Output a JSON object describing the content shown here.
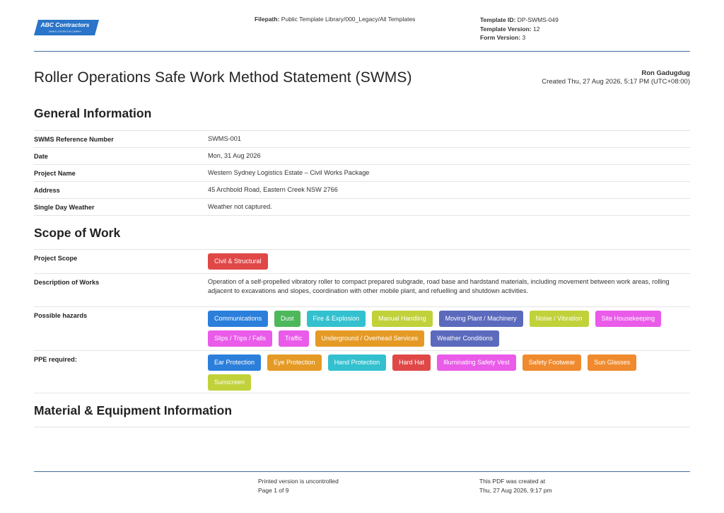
{
  "logo": {
    "name": "ABC Contractors",
    "subtitle": "SAMPLE CONTRACTOR COMPANY",
    "color": "#2a74c9"
  },
  "header": {
    "filepath_label": "Filepath:",
    "filepath_value": "Public Template Library/000_Legacy/All Templates",
    "template_id_label": "Template ID:",
    "template_id_value": "DP-SWMS-049",
    "template_version_label": "Template Version:",
    "template_version_value": "12",
    "form_version_label": "Form Version:",
    "form_version_value": "3"
  },
  "title": "Roller Operations Safe Work Method Statement (SWMS)",
  "created_by": "Ron Gadugdug",
  "created_at": "Created Thu, 27 Aug 2026, 5:17 PM (UTC+08:00)",
  "general": {
    "heading": "General Information",
    "rows": [
      {
        "label": "SWMS Reference Number",
        "value": "SWMS-001"
      },
      {
        "label": "Date",
        "value": "Mon, 31 Aug 2026"
      },
      {
        "label": "Project Name",
        "value": "Western Sydney Logistics Estate – Civil Works Package"
      },
      {
        "label": "Address",
        "value": "45 Archbold Road, Eastern Creek NSW 2766"
      },
      {
        "label": "Single Day Weather",
        "value": "Weather not captured."
      }
    ]
  },
  "scope": {
    "heading": "Scope of Work",
    "project_scope_label": "Project Scope",
    "project_scope_tags": [
      {
        "text": "Civil & Structural",
        "color": "#e04848"
      }
    ],
    "description_label": "Description of Works",
    "description": "Operation of a self-propelled vibratory roller to compact prepared subgrade, road base and hardstand materials, including movement between work areas, rolling adjacent to excavations and slopes, coordination with other mobile plant, and refuelling and shutdown activities.",
    "hazards_label": "Possible hazards",
    "hazards": [
      {
        "text": "Communications",
        "color": "#2b7fdb"
      },
      {
        "text": "Dust",
        "color": "#4cb85a"
      },
      {
        "text": "Fire & Explosion",
        "color": "#33c0cf"
      },
      {
        "text": "Manual Handling",
        "color": "#c1d13a"
      },
      {
        "text": "Moving Plant / Machinery",
        "color": "#5b6abc"
      },
      {
        "text": "Noise / Vibration",
        "color": "#c1d13a"
      },
      {
        "text": "Site Housekeeping",
        "color": "#e95be8"
      },
      {
        "text": "Slips / Trips / Falls",
        "color": "#e95be8"
      },
      {
        "text": "Traffic",
        "color": "#e95be8"
      },
      {
        "text": "Underground / Overhead Services",
        "color": "#e59a25"
      },
      {
        "text": "Weather Conditions",
        "color": "#5b6abc"
      }
    ],
    "ppe_label": "PPE required:",
    "ppe": [
      {
        "text": "Ear Protection",
        "color": "#2b7fdb"
      },
      {
        "text": "Eye Protection",
        "color": "#e59a25"
      },
      {
        "text": "Hand Protection",
        "color": "#33c0cf"
      },
      {
        "text": "Hard Hat",
        "color": "#e04848"
      },
      {
        "text": "Illuminating Safety Vest",
        "color": "#e95be8"
      },
      {
        "text": "Safety Footwear",
        "color": "#f08a2e"
      },
      {
        "text": "Sun Glasses",
        "color": "#f08a2e"
      },
      {
        "text": "Sunscreen",
        "color": "#c1d13a"
      }
    ]
  },
  "materials": {
    "heading": "Material & Equipment Information"
  },
  "footer": {
    "uncontrolled": "Printed version is uncontrolled",
    "page": "Page 1 of 9",
    "created_label": "This PDF was created at",
    "created_value": "Thu, 27 Aug 2026, 9:17 pm"
  }
}
